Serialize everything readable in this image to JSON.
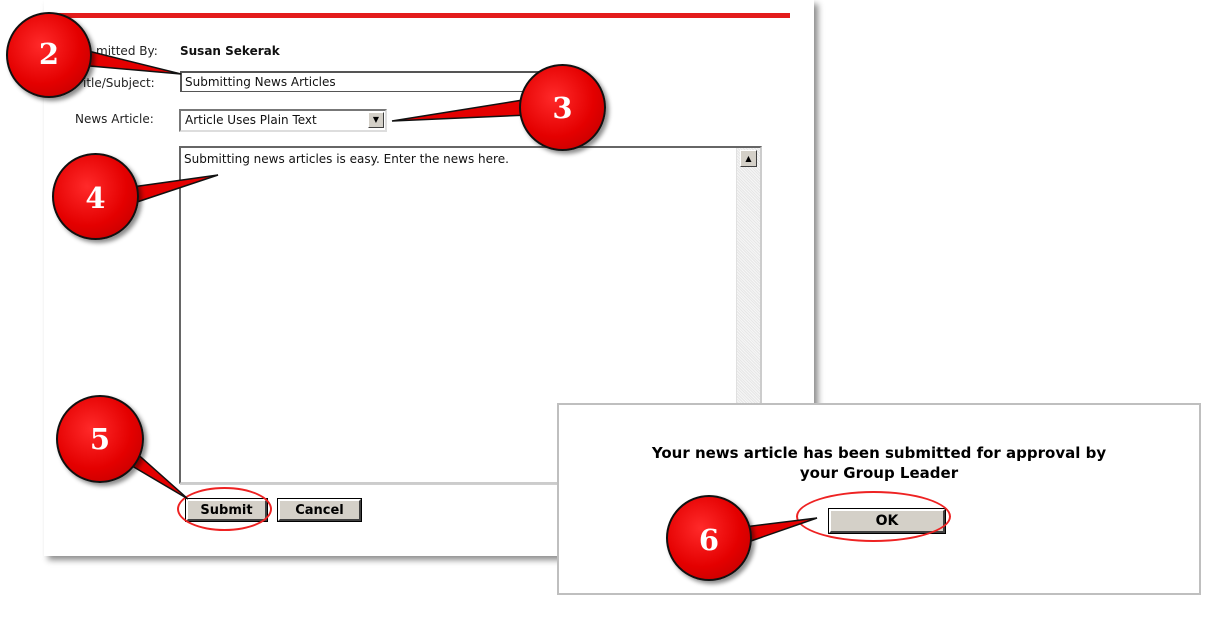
{
  "form": {
    "submitted_by_label": "mitted By:",
    "submitted_by_value": "Susan Sekerak",
    "title_label": "itle/Subject:",
    "title_value": "Submitting News Articles",
    "article_label": "News Article:",
    "article_format": "Article Uses Plain Text",
    "article_body": "Submitting news articles is easy. Enter the news here.",
    "submit_label": "Submit",
    "cancel_label": "Cancel"
  },
  "dialog": {
    "message_line1": "Your news article has been submitted for approval by",
    "message_line2": "your Group Leader",
    "ok_label": "OK"
  },
  "callouts": {
    "c2": "2",
    "c3": "3",
    "c4": "4",
    "c5": "5",
    "c6": "6"
  },
  "colors": {
    "accent": "#e31c1c",
    "callout": "#e40000",
    "button_face": "#d4d0c8"
  }
}
